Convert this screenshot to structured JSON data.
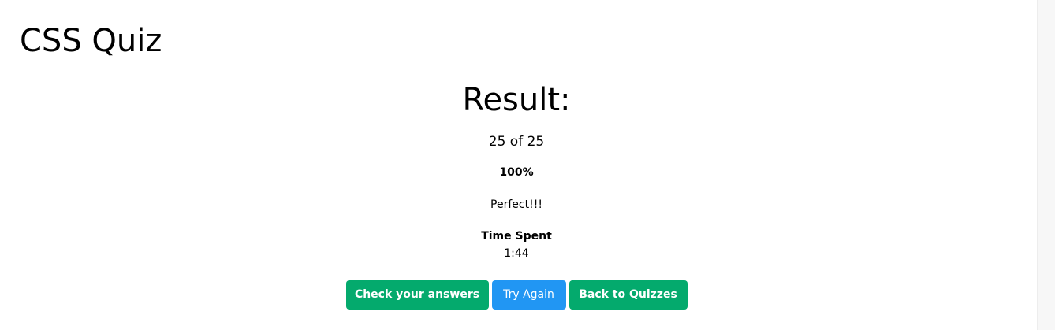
{
  "quiz": {
    "title": "CSS Quiz"
  },
  "result": {
    "heading": "Result:",
    "score": "25 of 25",
    "percent": "100%",
    "message": "Perfect!!!",
    "time_label": "Time Spent",
    "time_value": "1:44"
  },
  "actions": {
    "check_answers_label": "Check your answers",
    "try_again_label": "Try Again",
    "back_label": "Back to Quizzes"
  },
  "colors": {
    "green": "#04aa6d",
    "blue": "#2196f3",
    "text": "#000000",
    "background": "#ffffff"
  }
}
